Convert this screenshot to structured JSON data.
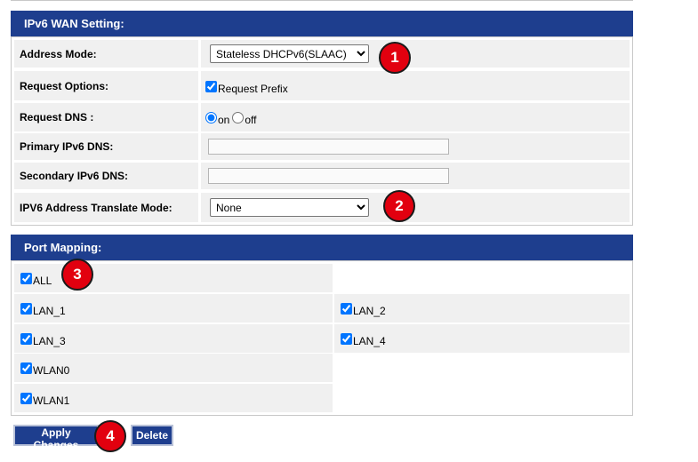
{
  "ipv6_wan": {
    "header": "IPv6 WAN Setting:",
    "address_mode": {
      "label": "Address Mode:",
      "selected": "Stateless DHCPv6(SLAAC)"
    },
    "request_options": {
      "label": "Request Options:",
      "checkbox_label": "Request Prefix",
      "checked": true
    },
    "request_dns": {
      "label": "Request DNS :",
      "on_label": "on",
      "off_label": "off",
      "selected": "on"
    },
    "primary_dns": {
      "label": "Primary IPv6 DNS:",
      "value": ""
    },
    "secondary_dns": {
      "label": "Secondary IPv6 DNS:",
      "value": ""
    },
    "translate_mode": {
      "label": "IPV6 Address Translate Mode:",
      "selected": "None"
    }
  },
  "port_mapping": {
    "header": "Port Mapping:",
    "ports": [
      {
        "label": "ALL",
        "checked": true
      },
      {
        "label": "LAN_1",
        "checked": true
      },
      {
        "label": "LAN_2",
        "checked": true
      },
      {
        "label": "LAN_3",
        "checked": true
      },
      {
        "label": "LAN_4",
        "checked": true
      },
      {
        "label": "WLAN0",
        "checked": true
      },
      {
        "label": "WLAN1",
        "checked": true
      }
    ]
  },
  "buttons": {
    "apply": "Apply Changes",
    "delete": "Delete"
  },
  "badges": [
    "1",
    "2",
    "3",
    "4"
  ],
  "colors": {
    "header_bg": "#1e3e8e",
    "badge": "#e2000f",
    "row_bg": "#f0f0f0"
  }
}
